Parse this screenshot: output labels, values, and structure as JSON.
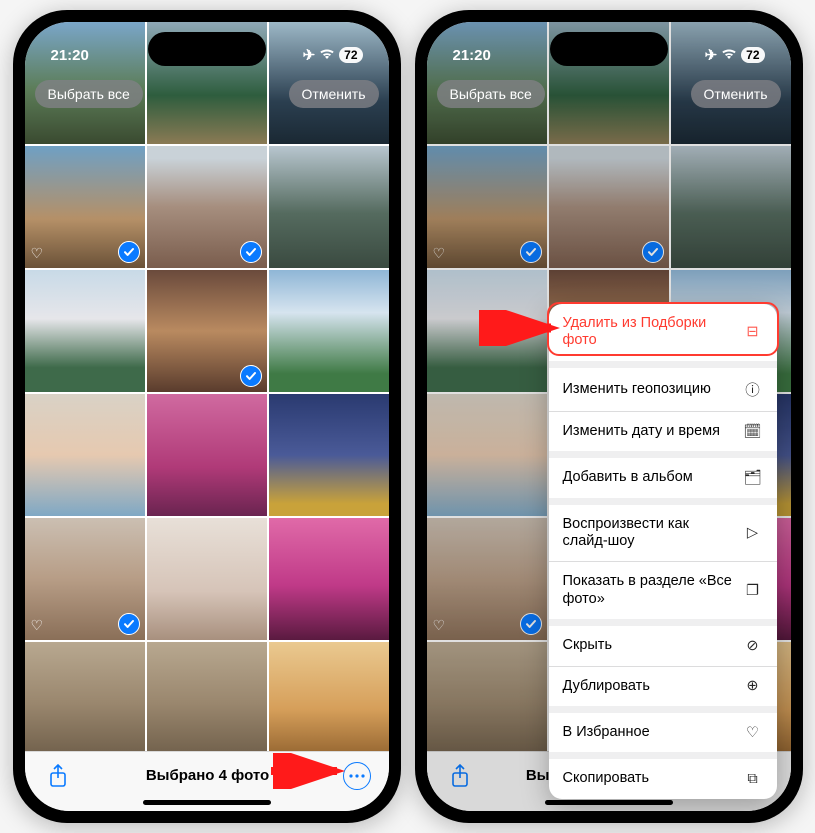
{
  "status": {
    "time": "21:20",
    "battery": "72"
  },
  "topButtons": {
    "selectAll": "Выбрать все",
    "cancel": "Отменить"
  },
  "bottom": {
    "selectedText": "Выбрано 4 фото"
  },
  "grid": [
    {
      "palette": "p1",
      "selected": false,
      "heart": false
    },
    {
      "palette": "p2",
      "selected": false,
      "heart": false
    },
    {
      "palette": "p3",
      "selected": false,
      "heart": false
    },
    {
      "palette": "p4",
      "selected": true,
      "heart": true
    },
    {
      "palette": "p5",
      "selected": true,
      "heart": false
    },
    {
      "palette": "p6",
      "selected": false,
      "heart": false
    },
    {
      "palette": "p7",
      "selected": false,
      "heart": false
    },
    {
      "palette": "p8",
      "selected": true,
      "heart": false
    },
    {
      "palette": "p9",
      "selected": false,
      "heart": false
    },
    {
      "palette": "p10",
      "selected": false,
      "heart": false
    },
    {
      "palette": "p11",
      "selected": false,
      "heart": false
    },
    {
      "palette": "p12",
      "selected": false,
      "heart": false
    },
    {
      "palette": "p13",
      "selected": true,
      "heart": true
    },
    {
      "palette": "p14",
      "selected": false,
      "heart": false
    },
    {
      "palette": "p15",
      "selected": false,
      "heart": false
    },
    {
      "palette": "p16",
      "selected": false,
      "heart": false
    },
    {
      "palette": "p16",
      "selected": false,
      "heart": false
    },
    {
      "palette": "p17",
      "selected": false,
      "heart": false
    }
  ],
  "menu": [
    {
      "group": 0,
      "label": "Удалить из Подборки фото",
      "icon": "remove-from-featured-icon",
      "destructive": true
    },
    {
      "group": 1,
      "label": "Изменить геопозицию",
      "icon": "location-icon",
      "destructive": false
    },
    {
      "group": 1,
      "label": "Изменить дату и время",
      "icon": "calendar-icon",
      "destructive": false
    },
    {
      "group": 2,
      "label": "Добавить в альбом",
      "icon": "album-add-icon",
      "destructive": false
    },
    {
      "group": 3,
      "label": "Воспроизвести как слайд-шоу",
      "icon": "play-icon",
      "destructive": false
    },
    {
      "group": 3,
      "label": "Показать в разделе «Все фото»",
      "icon": "stack-icon",
      "destructive": false
    },
    {
      "group": 4,
      "label": "Скрыть",
      "icon": "eye-slash-icon",
      "destructive": false
    },
    {
      "group": 4,
      "label": "Дублировать",
      "icon": "duplicate-icon",
      "destructive": false
    },
    {
      "group": 5,
      "label": "В Избранное",
      "icon": "heart-icon",
      "destructive": false
    },
    {
      "group": 6,
      "label": "Скопировать",
      "icon": "copy-icon",
      "destructive": false
    }
  ],
  "icons": {
    "remove-from-featured-icon": "⊟",
    "location-icon": "ⓘ",
    "calendar-icon": "🗓",
    "album-add-icon": "🗂",
    "play-icon": "▷",
    "stack-icon": "❐",
    "eye-slash-icon": "⊘",
    "duplicate-icon": "⊕",
    "heart-icon": "♡",
    "copy-icon": "⧉"
  }
}
